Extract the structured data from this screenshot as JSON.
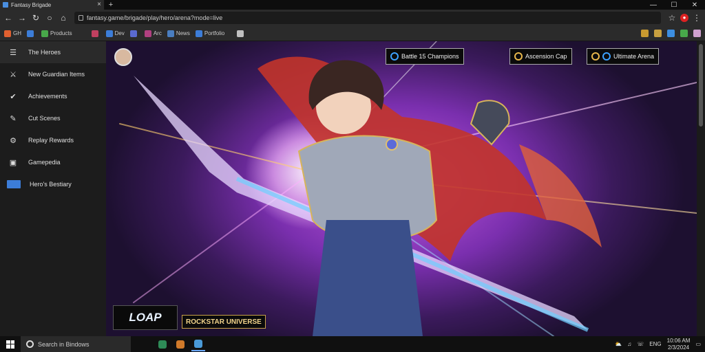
{
  "browser": {
    "tab_title": "Fantasy Brigade",
    "address": "fantasy.game/brigade/play/hero/arena?mode=live",
    "window_controls": {
      "minimize": "—",
      "maximize": "☐",
      "close": "✕"
    }
  },
  "bookmarks": {
    "items": [
      {
        "label": "GH",
        "color": "#e06030"
      },
      {
        "label": "",
        "color": "#3c7dd8"
      },
      {
        "label": "Products",
        "color": "#48a84a"
      },
      {
        "label": "",
        "color": "#c04060"
      },
      {
        "label": "Dev",
        "color": "#3c7dd8"
      },
      {
        "label": "",
        "color": "#5a6ad0"
      },
      {
        "label": "Arc",
        "color": "#b04080"
      },
      {
        "label": "News",
        "color": "#4a7ec0"
      },
      {
        "label": "Portfolio",
        "color": "#3c7dd8"
      },
      {
        "label": "",
        "color": "#c0c0c0"
      }
    ],
    "right_icons": [
      "#c89a30",
      "#c8a040",
      "#3c8ee0",
      "#48a84a",
      "#d0a0d0"
    ]
  },
  "sidebar": {
    "items": [
      {
        "icon": "☰",
        "label": "The Heroes",
        "icon_name": "menu-icon"
      },
      {
        "icon": "⚔",
        "label": "New Guardian Items",
        "icon_name": "swords-icon"
      },
      {
        "icon": "✔",
        "label": "Achievements",
        "icon_name": "check-icon"
      },
      {
        "icon": "✎",
        "label": "Cut Scenes",
        "icon_name": "pen-icon"
      },
      {
        "icon": "⚙",
        "label": "Replay Rewards",
        "icon_name": "gear-icon"
      },
      {
        "icon": "▣",
        "label": "Gamepedia",
        "icon_name": "book-icon"
      },
      {
        "icon": "",
        "label": "Hero's Bestiary",
        "icon_name": "highlight-icon"
      }
    ]
  },
  "hud": {
    "pill1": "Battle 15 Champions",
    "pill2": "Ascension Cap",
    "pill3": "Ultimate Arena"
  },
  "overlay": {
    "logo": "LOAP",
    "tagline": "ROCKSTAR UNIVERSE"
  },
  "taskbar": {
    "search_placeholder": "Search in Bindows",
    "apps": [
      "#2e8b57",
      "#d07a2a",
      "#4a9ad8"
    ],
    "tray": [
      "⛅",
      "♫",
      "☏",
      "ENG"
    ],
    "time": "10:06 AM",
    "date": "2/3/2024"
  }
}
